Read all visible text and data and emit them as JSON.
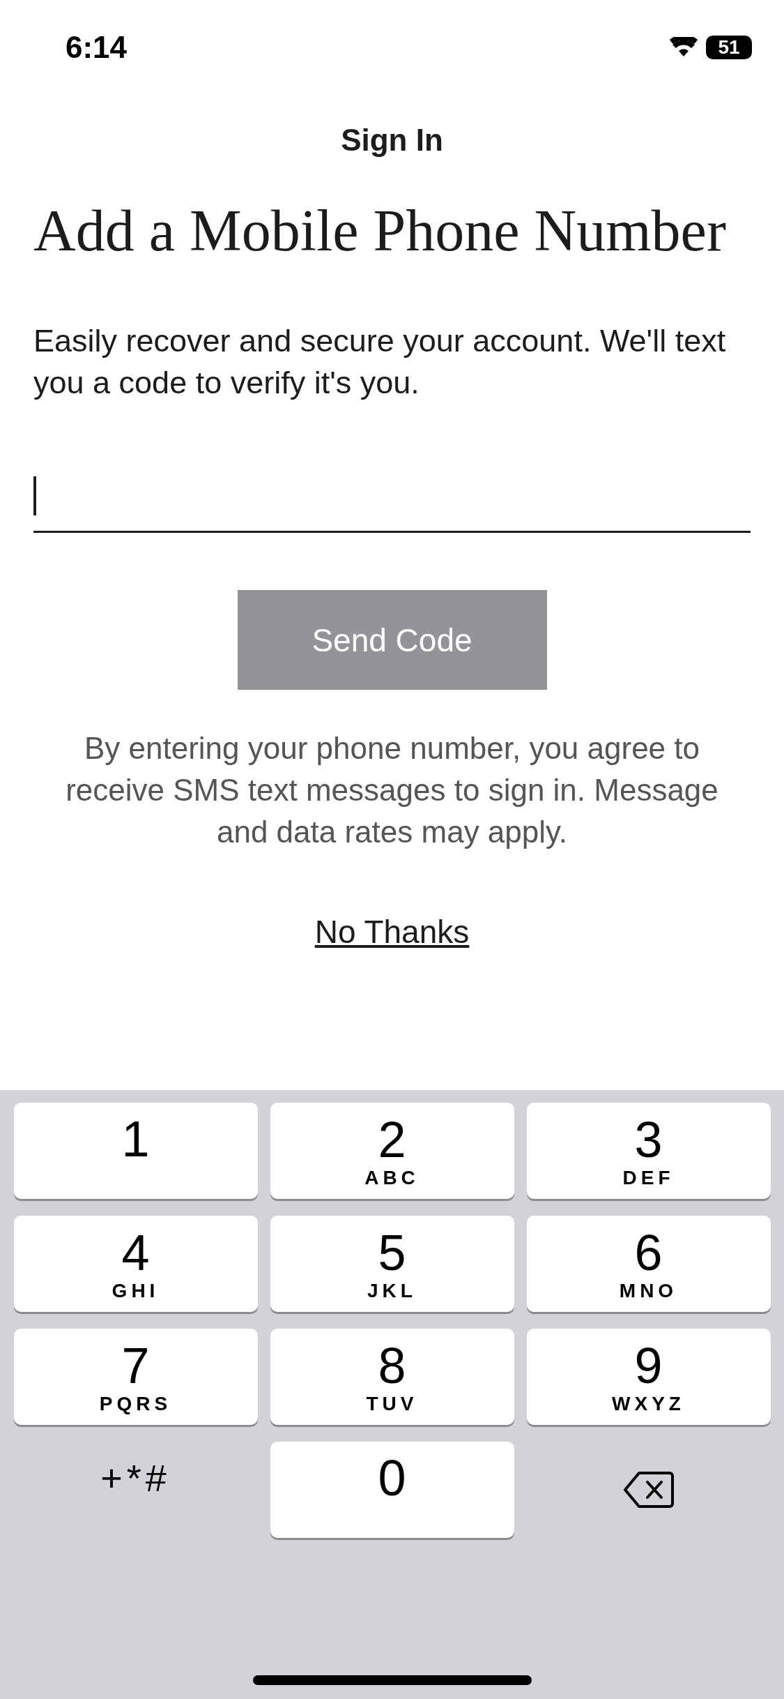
{
  "status_bar": {
    "time": "6:14",
    "battery": "51"
  },
  "nav": {
    "title": "Sign In"
  },
  "heading": "Add a Mobile Phone Number",
  "description": "Easily recover and secure your account. We'll text you a code to verify it's you.",
  "phone_field": {
    "focused": true
  },
  "send_button": {
    "label": "Send Code",
    "disabled": true
  },
  "disclaimer": "By entering your phone number, you agree to receive SMS text messages to sign in. Message and data rates may apply.",
  "no_thanks": "No Thanks",
  "keypad": [
    {
      "kind": "digit",
      "digit": "1"
    },
    {
      "kind": "digit",
      "digit": "2",
      "letters": "ABC"
    },
    {
      "kind": "digit",
      "digit": "3",
      "letters": "DEF"
    },
    {
      "kind": "digit",
      "digit": "4",
      "letters": "GHI"
    },
    {
      "kind": "digit",
      "digit": "5",
      "letters": "JKL"
    },
    {
      "kind": "digit",
      "digit": "6",
      "letters": "MNO"
    },
    {
      "kind": "digit",
      "digit": "7",
      "letters": "PQRS"
    },
    {
      "kind": "digit",
      "digit": "8",
      "letters": "TUV"
    },
    {
      "kind": "digit",
      "digit": "9",
      "letters": "WXYZ"
    },
    {
      "kind": "symbols",
      "digit": "+*#"
    },
    {
      "kind": "digit",
      "digit": "0"
    },
    {
      "kind": "delete"
    }
  ]
}
